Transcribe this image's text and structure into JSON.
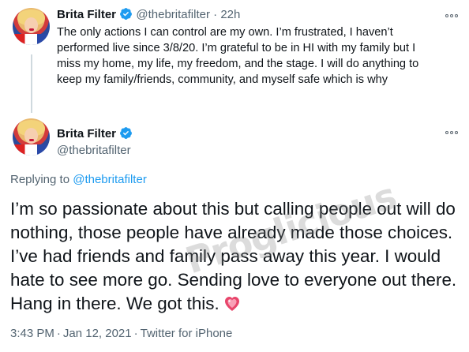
{
  "tweet1": {
    "author_name": "Brita Filter",
    "handle": "@thebritafilter",
    "separator": "·",
    "time_ago": "22h",
    "lines": [
      "The only actions I can control are my own. I’m frustrated, I haven’t",
      "performed live since 3/8/20. I’m grateful to be in HI with my family but I",
      "miss my home, my life, my freedom, and the stage. I will do anything to",
      "keep my family/friends, community, and myself safe which is why"
    ],
    "avatar_icon": "avatar-photo",
    "more_icon": "more-options-icon"
  },
  "tweet2": {
    "author_name": "Brita Filter",
    "handle": "@thebritafilter",
    "replying_prefix": "Replying to",
    "replying_to": "@thebritafilter",
    "lines": [
      "I’m so passionate about this but calling people out will do",
      "nothing, those people have already made those choices.",
      "I’ve had friends and family pass away this year. I would",
      "hate to see more go. Sending love to everyone out there.",
      "Hang in there. We got this."
    ],
    "emoji_icon": "sparkling-heart-icon",
    "time": "3:43 PM",
    "separator": "·",
    "date": "Jan 12, 2021",
    "source": "Twitter for iPhone"
  },
  "watermark": "Proglicious",
  "colors": {
    "text": "#0f1419",
    "muted": "#536471",
    "link": "#1d9bf0",
    "verified": "#1d9bf0",
    "thread_line": "#cfd9de",
    "heart": "#e8456b"
  }
}
